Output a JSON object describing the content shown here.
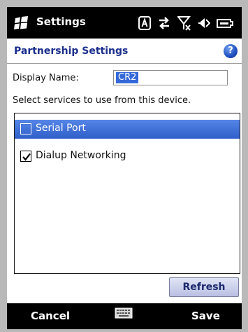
{
  "titlebar": {
    "title": "Settings",
    "icons": [
      "windows-logo-icon",
      "keyboard-lock-icon",
      "connectivity-icon",
      "no-signal-icon",
      "speaker-mute-icon",
      "battery-icon"
    ]
  },
  "header": {
    "title": "Partnership Settings",
    "help_icon": "help-icon",
    "help_glyph": "?"
  },
  "form": {
    "display_name_label": "Display Name:",
    "display_name_value": "CR2",
    "services_label": "Select services to use from this device."
  },
  "services": [
    {
      "label": "Serial Port",
      "checked": false,
      "selected": true
    },
    {
      "label": "Dialup Networking",
      "checked": true,
      "selected": false
    }
  ],
  "buttons": {
    "refresh": "Refresh"
  },
  "softkeys": {
    "left": "Cancel",
    "center_icon": "keyboard-icon",
    "right": "Save"
  },
  "colors": {
    "accent": "#2f5fc9",
    "header_text": "#1c2f8c",
    "title_bar": "#000000"
  }
}
